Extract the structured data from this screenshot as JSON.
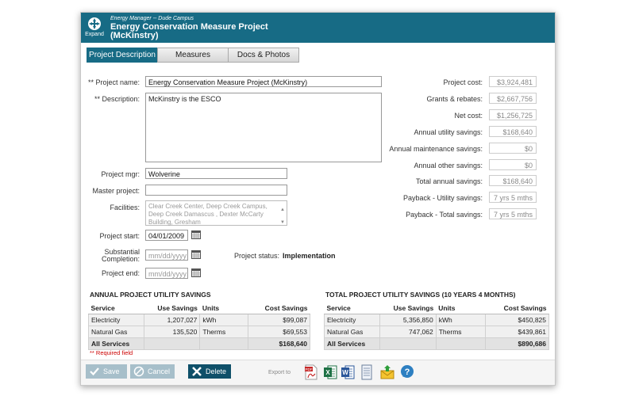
{
  "header": {
    "expand_label": "Expand",
    "app_context": "Energy Manager -- Dude Campus",
    "title": "Energy Conservation Measure Project (McKinstry)"
  },
  "tabs": [
    {
      "label": "Project Description",
      "active": true
    },
    {
      "label": "Measures",
      "active": false
    },
    {
      "label": "Docs & Photos",
      "active": false
    }
  ],
  "form": {
    "project_name_label": "** Project name:",
    "project_name_value": "Energy Conservation Measure Project (McKinstry)",
    "description_label": "** Description:",
    "description_value": "McKinstry is the ESCO",
    "project_mgr_label": "Project mgr:",
    "project_mgr_value": "Wolverine",
    "master_project_label": "Master project:",
    "master_project_value": "",
    "facilities_label": "Facilities:",
    "facilities_value": "Clear Creek Center, Deep Creek Campus, Deep Creek Damascus , Dexter McCarty Building, Gresham",
    "project_start_label": "Project start:",
    "project_start_value": "04/01/2009",
    "substantial_label_1": "Substantial",
    "substantial_label_2": "Completion:",
    "substantial_placeholder": "mm/dd/yyyy",
    "project_end_label": "Project end:",
    "project_end_placeholder": "mm/dd/yyyy",
    "project_status_label": "Project status:",
    "project_status_value": "Implementation"
  },
  "financials": [
    {
      "label": "Project cost:",
      "value": "$3,924,481"
    },
    {
      "label": "Grants & rebates:",
      "value": "$2,667,756"
    },
    {
      "label": "Net cost:",
      "value": "$1,256,725"
    },
    {
      "label": "Annual utility savings:",
      "value": "$168,640"
    },
    {
      "label": "Annual maintenance savings:",
      "value": "$0"
    },
    {
      "label": "Annual other savings:",
      "value": "$0"
    },
    {
      "label": "Total annual savings:",
      "value": "$168,640"
    },
    {
      "label": "Payback - Utility savings:",
      "value": "7 yrs 5 mths"
    },
    {
      "label": "Payback - Total savings:",
      "value": "7 yrs 5 mths"
    }
  ],
  "annual_savings": {
    "title": "ANNUAL PROJECT UTILITY SAVINGS",
    "headers": [
      "Service",
      "Use Savings",
      "Units",
      "Cost Savings"
    ],
    "rows": [
      [
        "Electricity",
        "1,207,027",
        "kWh",
        "$99,087"
      ],
      [
        "Natural Gas",
        "135,520",
        "Therms",
        "$69,553"
      ]
    ],
    "total": [
      "All Services",
      "",
      "",
      "$168,640"
    ]
  },
  "total_savings": {
    "title": "TOTAL PROJECT UTILITY SAVINGS (10 YEARS 4 MONTHS)",
    "headers": [
      "Service",
      "Use Savings",
      "Units",
      "Cost Savings"
    ],
    "rows": [
      [
        "Electricity",
        "5,356,850",
        "kWh",
        "$450,825"
      ],
      [
        "Natural Gas",
        "747,062",
        "Therms",
        "$439,861"
      ]
    ],
    "total": [
      "All Services",
      "",
      "",
      "$890,686"
    ]
  },
  "required_note": "** Required field",
  "buttons": {
    "save": "Save",
    "cancel": "Cancel",
    "delete": "Delete"
  },
  "export_label": "Export to",
  "colors": {
    "header_bg": "#176b85",
    "delete_btn": "#0f5069",
    "disabled_btn": "#a7bfca",
    "required_text": "#cc0000"
  }
}
